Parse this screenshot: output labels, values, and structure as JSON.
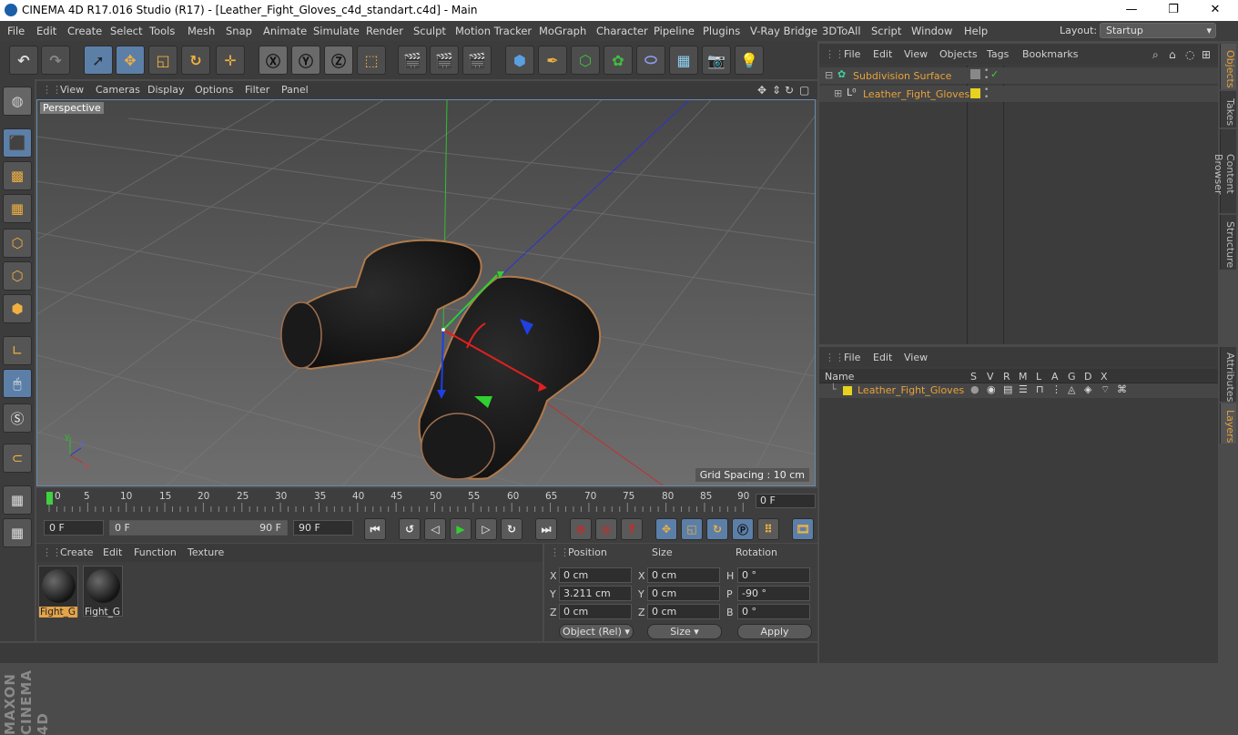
{
  "window": {
    "title": "CINEMA 4D R17.016 Studio (R17) - [Leather_Fight_Gloves_c4d_standart.c4d] - Main",
    "minimize": "—",
    "maximize": "❐",
    "close": "✕"
  },
  "menu": [
    "File",
    "Edit",
    "Create",
    "Select",
    "Tools",
    "Mesh",
    "Snap",
    "Animate",
    "Simulate",
    "Render",
    "Sculpt",
    "Motion Tracker",
    "MoGraph",
    "Character",
    "Pipeline",
    "Plugins",
    "V-Ray Bridge",
    "3DToAll",
    "Script",
    "Window",
    "Help"
  ],
  "layout": {
    "label": "Layout:",
    "value": "Startup"
  },
  "viewport": {
    "menu": [
      "View",
      "Cameras",
      "Display",
      "Options",
      "Filter",
      "Panel"
    ],
    "label": "Perspective",
    "grid_spacing": "Grid Spacing : 10 cm"
  },
  "timeline": {
    "ticks": [
      "0",
      "5",
      "10",
      "15",
      "20",
      "25",
      "30",
      "35",
      "40",
      "45",
      "50",
      "55",
      "60",
      "65",
      "70",
      "75",
      "80",
      "85",
      "90"
    ],
    "current_frame": "0 F"
  },
  "transport": {
    "start": "0 F",
    "range_start": "0 F",
    "range_end": "90 F",
    "end": "90 F"
  },
  "materials": {
    "menu": [
      "Create",
      "Edit",
      "Function",
      "Texture"
    ],
    "items": [
      {
        "label": "Fight_G"
      },
      {
        "label": "Fight_G"
      }
    ]
  },
  "coords": {
    "headers": [
      "Position",
      "Size",
      "Rotation"
    ],
    "rows": [
      {
        "axis": "X",
        "pos": "0 cm",
        "saxis": "X",
        "size": "0 cm",
        "raxis": "H",
        "rot": "0 °"
      },
      {
        "axis": "Y",
        "pos": "3.211 cm",
        "saxis": "Y",
        "size": "0 cm",
        "raxis": "P",
        "rot": "-90 °"
      },
      {
        "axis": "Z",
        "pos": "0 cm",
        "saxis": "Z",
        "size": "0 cm",
        "raxis": "B",
        "rot": "0 °"
      }
    ],
    "mode": "Object (Rel)",
    "size_mode": "Size",
    "apply": "Apply"
  },
  "objects": {
    "menu": [
      "File",
      "Edit",
      "View",
      "Objects",
      "Tags",
      "Bookmarks"
    ],
    "items": [
      {
        "name": "Subdivision Surface"
      },
      {
        "name": "Leather_Fight_Gloves"
      }
    ]
  },
  "layers": {
    "menu": [
      "File",
      "Edit",
      "View"
    ],
    "columns": [
      "Name",
      "S",
      "V",
      "R",
      "M",
      "L",
      "A",
      "G",
      "D",
      "X"
    ],
    "items": [
      {
        "name": "Leather_Fight_Gloves"
      }
    ]
  },
  "side_tabs": [
    "Objects",
    "Takes",
    "Content Browser",
    "Structure",
    "Attributes",
    "Layers"
  ],
  "brand": "MAXON CINEMA 4D",
  "colors": {
    "accent": "#e9a23b",
    "selection": "#5c7fa8",
    "layer": "#e6d21f"
  }
}
